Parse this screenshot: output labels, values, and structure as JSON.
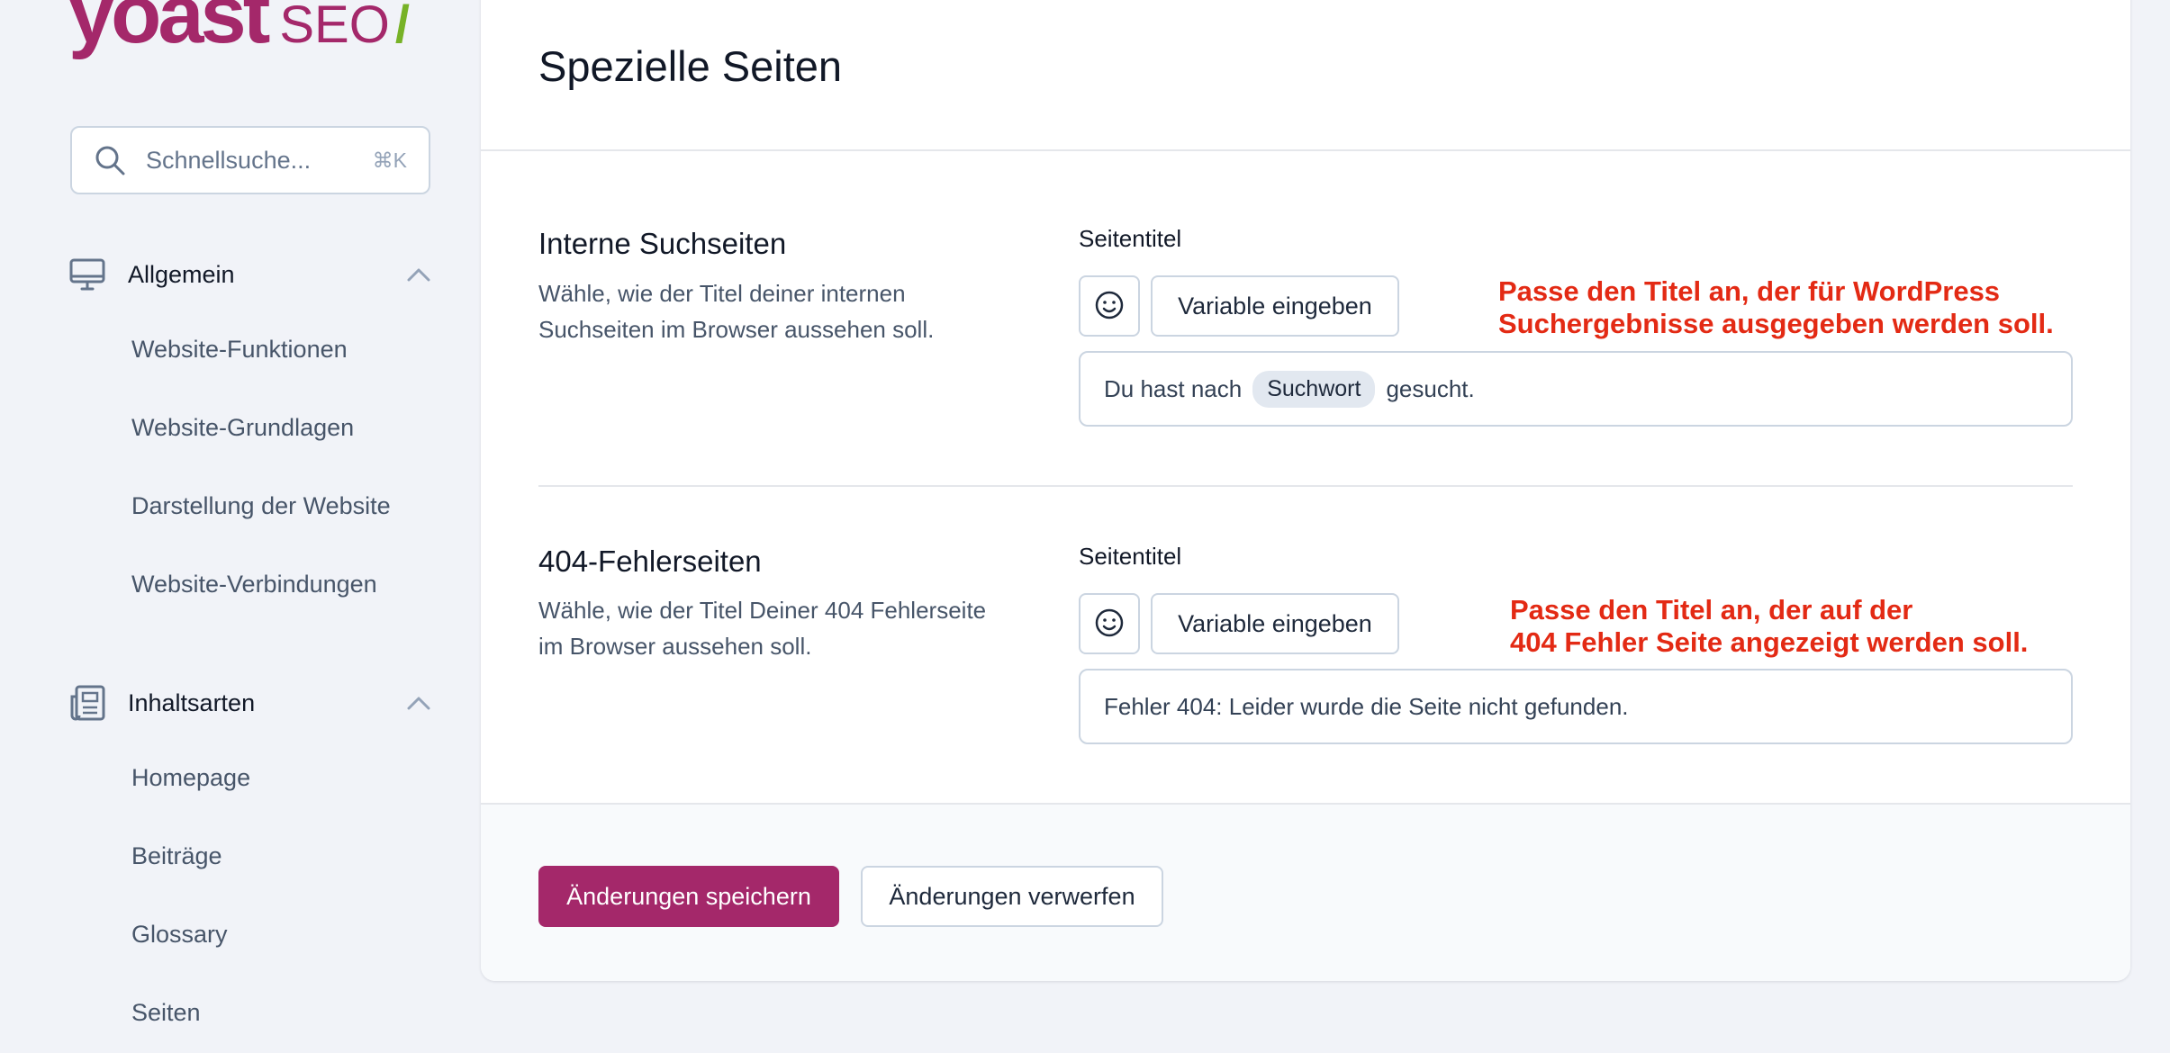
{
  "brand": {
    "name": "yoast",
    "product": "SEO",
    "slash": "/",
    "primary_color": "#a4286a",
    "accent_color": "#77b227"
  },
  "search": {
    "placeholder": "Schnellsuche...",
    "shortcut": "⌘K"
  },
  "sidebar": {
    "groups": [
      {
        "label": "Allgemein",
        "icon": "desktop-icon",
        "expanded": true,
        "items": [
          "Website-Funktionen",
          "Website-Grundlagen",
          "Darstellung der Website",
          "Website-Verbindungen"
        ]
      },
      {
        "label": "Inhaltsarten",
        "icon": "newspaper-icon",
        "expanded": true,
        "items": [
          "Homepage",
          "Beiträge",
          "Glossary",
          "Seiten"
        ]
      }
    ]
  },
  "main": {
    "title": "Spezielle Seiten",
    "sections": [
      {
        "title": "Interne Suchseiten",
        "description": "Wähle, wie der Titel deiner internen Suchseiten im Browser aussehen soll.",
        "field_label": "Seitentitel",
        "variable_button": "Variable eingeben",
        "value_prefix": "Du hast nach",
        "value_variable": "Suchwort",
        "value_suffix": "gesucht.",
        "annotation_line1": "Passe den Titel an, der für WordPress",
        "annotation_line2": "Suchergebnisse ausgegeben werden soll."
      },
      {
        "title": "404-Fehlerseiten",
        "description": "Wähle, wie der Titel Deiner 404 Fehlerseite im Browser aussehen soll.",
        "field_label": "Seitentitel",
        "variable_button": "Variable eingeben",
        "value": "Fehler 404: Leider wurde die Seite nicht gefunden.",
        "annotation_line1": "Passe den Titel an, der auf der",
        "annotation_line2": "404 Fehler Seite angezeigt werden soll."
      }
    ],
    "footer": {
      "save_label": "Änderungen speichern",
      "discard_label": "Änderungen verwerfen"
    }
  },
  "colors": {
    "annotation": "#e32a14",
    "background": "#f1f3f8"
  }
}
